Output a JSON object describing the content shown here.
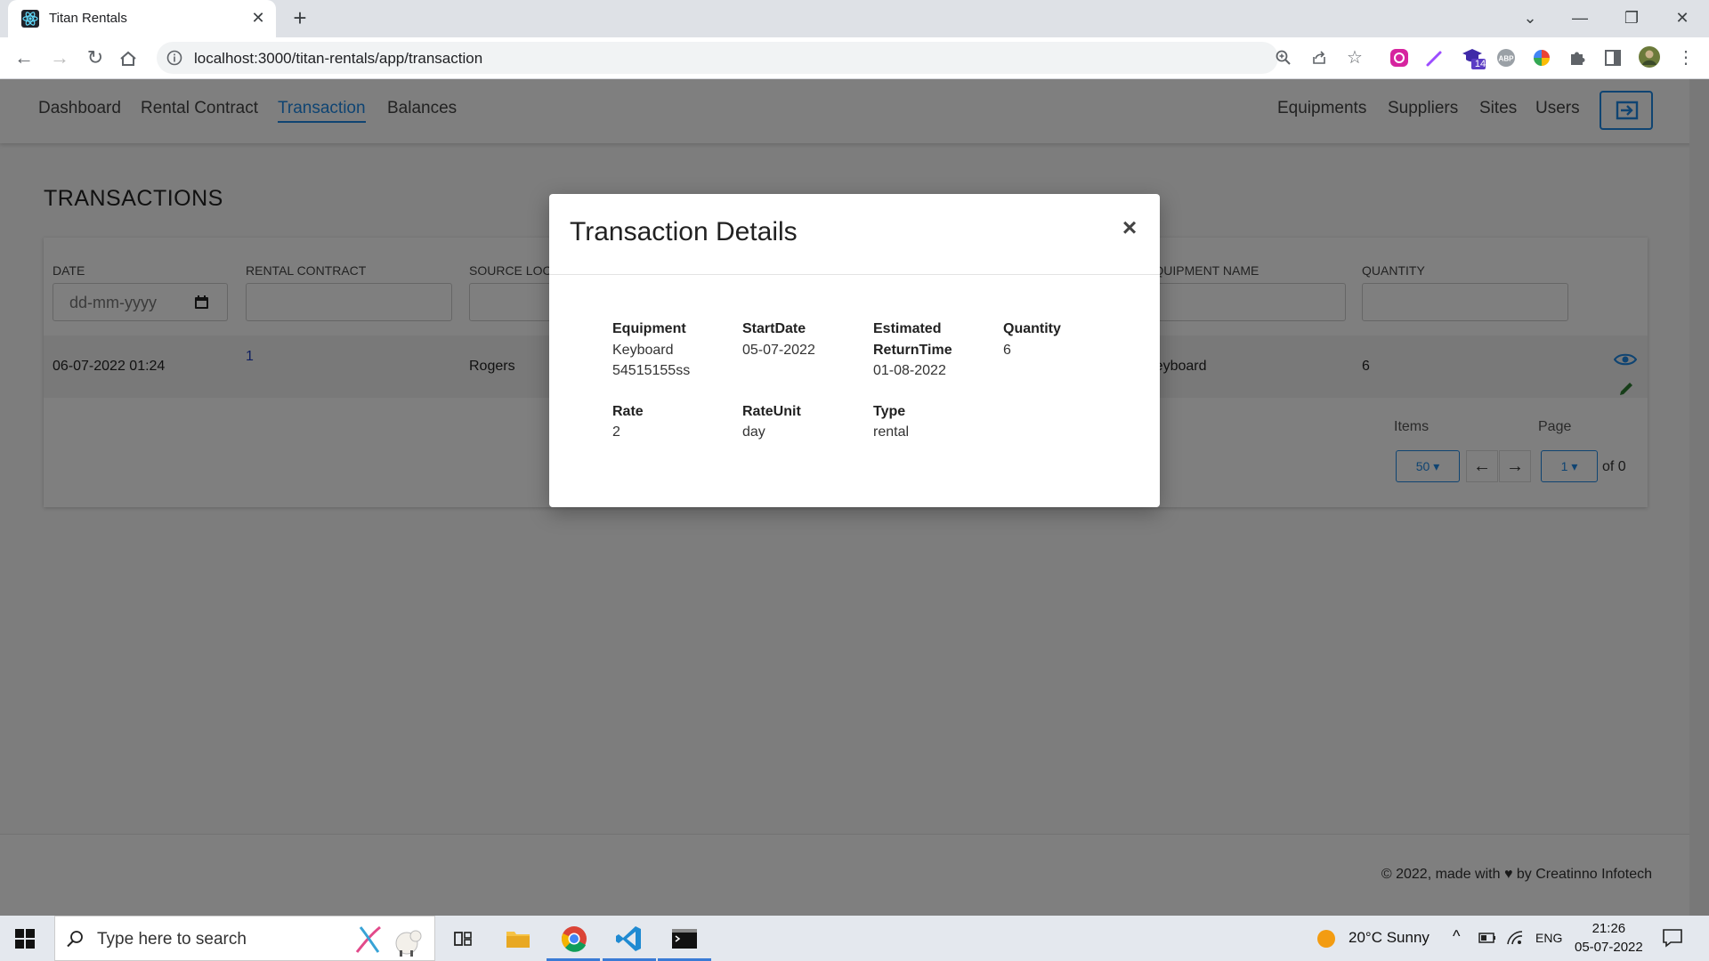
{
  "browser": {
    "tab_title": "Titan Rentals",
    "url": "localhost:3000/titan-rentals/app/transaction",
    "extension_badge": "14"
  },
  "nav": {
    "left": [
      "Dashboard",
      "Rental Contract",
      "Transaction",
      "Balances"
    ],
    "right": [
      "Equipments",
      "Suppliers",
      "Sites",
      "Users"
    ],
    "active": "Transaction"
  },
  "page": {
    "title": "TRANSACTIONS",
    "columns": [
      "DATE",
      "RENTAL CONTRACT",
      "SOURCE LOCATION",
      "EQUIPMENT NAME",
      "QUANTITY"
    ],
    "date_placeholder": "dd-mm-yyyy",
    "row": {
      "date": "06-07-2022 01:24",
      "rental_contract": "1",
      "source_location": "Rogers",
      "equipment_name": "Keyboard",
      "quantity": "6"
    },
    "pagination": {
      "items_label": "Items",
      "page_label": "Page",
      "items_value": "50",
      "page_value": "1",
      "of_text": "of 0"
    }
  },
  "footer": {
    "text_before": "© 2022, made with",
    "text_after": "by Creatinno Infotech"
  },
  "modal": {
    "title": "Transaction Details",
    "fields": {
      "equipment_label": "Equipment",
      "equipment_value_1": "Keyboard",
      "equipment_value_2": "54515155ss",
      "startdate_label": "StartDate",
      "startdate_value": "05-07-2022",
      "return_label_1": "Estimated",
      "return_label_2": "ReturnTime",
      "return_value": "01-08-2022",
      "quantity_label": "Quantity",
      "quantity_value": "6",
      "rate_label": "Rate",
      "rate_value": "2",
      "rateunit_label": "RateUnit",
      "rateunit_value": "day",
      "type_label": "Type",
      "type_value": "rental"
    }
  },
  "taskbar": {
    "search_placeholder": "Type here to search",
    "weather": "20°C  Sunny",
    "language": "ENG",
    "time": "21:26",
    "date": "05-07-2022"
  },
  "colors": {
    "accent": "#1e88e5",
    "link": "#1e3fbf",
    "overlay": "rgba(0,0,0,0.5)",
    "edit": "#2e7d32"
  }
}
